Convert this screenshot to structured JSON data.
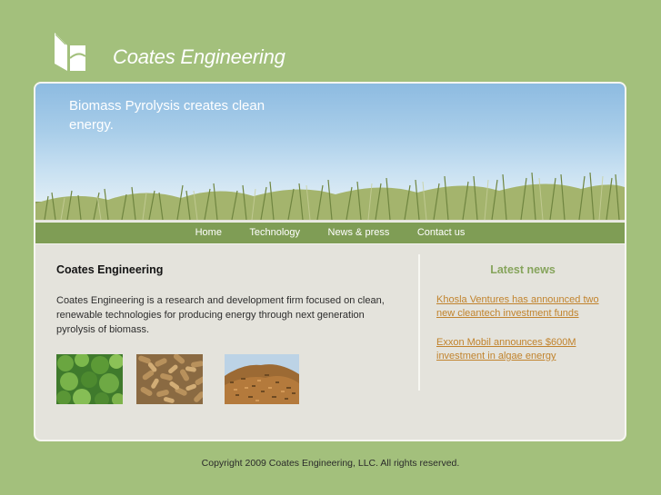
{
  "header": {
    "logo_icon": "leaf-logo-icon",
    "site_title": "Coates Engineering"
  },
  "hero": {
    "tagline": "Biomass Pyrolysis creates clean energy."
  },
  "nav": {
    "items": [
      {
        "label": "Home"
      },
      {
        "label": "Technology"
      },
      {
        "label": "News & press"
      },
      {
        "label": "Contact us"
      }
    ]
  },
  "main": {
    "heading": "Coates Engineering",
    "body": "Coates Engineering is a research and development firm focused on clean, renewable technologies for producing energy through next generation pyrolysis of biomass.",
    "images": [
      {
        "name": "algae-photo"
      },
      {
        "name": "wood-pellets-photo"
      },
      {
        "name": "wood-chips-pile-photo"
      }
    ]
  },
  "sidebar": {
    "heading": "Latest news",
    "news": [
      {
        "text": "Khosla Ventures has announced two new cleantech investment funds"
      },
      {
        "text": "Exxon Mobil announces $600M investment in algae energy"
      }
    ]
  },
  "footer": {
    "copyright": "Copyright 2009 Coates Engineering, LLC. All rights reserved."
  },
  "colors": {
    "page_background": "#a3c07c",
    "nav_background": "#7f9d55",
    "content_background": "#e4e3dc",
    "news_heading": "#86a45c",
    "news_link": "#c1832d"
  }
}
